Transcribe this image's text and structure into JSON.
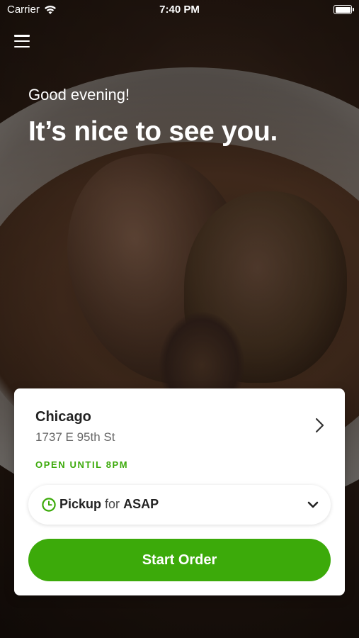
{
  "status_bar": {
    "carrier": "Carrier",
    "time": "7:40 PM",
    "icons": [
      "wifi-icon",
      "battery-icon"
    ]
  },
  "header": {
    "menu_icon": "hamburger-menu-icon"
  },
  "hero": {
    "greeting": "Good evening!",
    "headline": "It’s nice to see you."
  },
  "location_card": {
    "name": "Chicago",
    "address": "1737 E 95th St",
    "hours": "OPEN UNTIL 8PM",
    "chevron_icon": "chevron-right-icon"
  },
  "order_mode": {
    "icon": "clock-icon",
    "mode": "Pickup",
    "connector": "for",
    "time": "ASAP",
    "dropdown_icon": "chevron-down-icon"
  },
  "cta": {
    "label": "Start Order"
  },
  "colors": {
    "accent": "#3caa0a",
    "card_background": "#ffffff",
    "text_primary": "#222222",
    "text_secondary": "#666666"
  }
}
